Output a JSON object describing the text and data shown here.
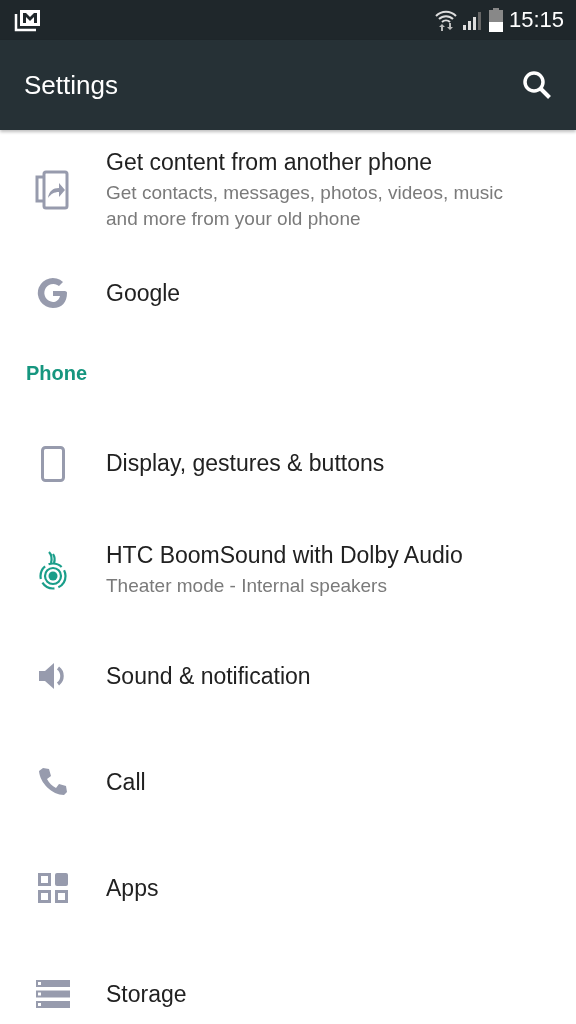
{
  "status_bar": {
    "time": "15:15"
  },
  "app_bar": {
    "title": "Settings"
  },
  "rows": [
    {
      "kind": "item",
      "title": "Get content from another phone",
      "subtitle": "Get contacts, messages, photos, videos, music and more from your old phone"
    },
    {
      "kind": "item",
      "title": "Google"
    },
    {
      "kind": "header",
      "title": "Phone"
    },
    {
      "kind": "item",
      "title": "Display, gestures & buttons"
    },
    {
      "kind": "item",
      "title": "HTC BoomSound with Dolby Audio",
      "subtitle": "Theater mode - Internal speakers"
    },
    {
      "kind": "item",
      "title": "Sound & notification"
    },
    {
      "kind": "item",
      "title": "Call"
    },
    {
      "kind": "item",
      "title": "Apps"
    },
    {
      "kind": "item",
      "title": "Storage"
    }
  ]
}
